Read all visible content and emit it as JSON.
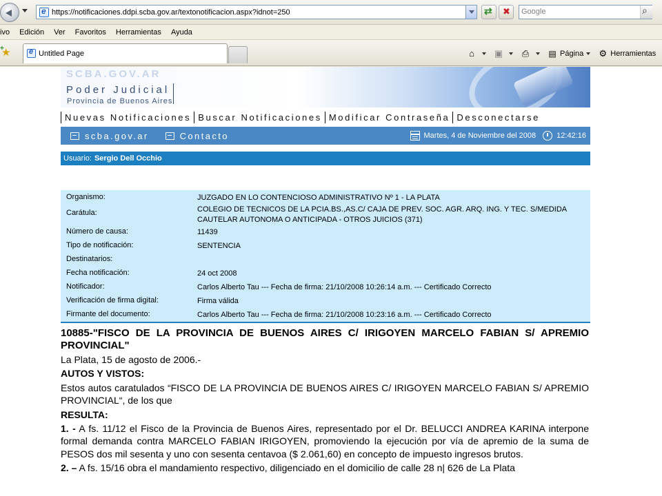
{
  "browser": {
    "url": "https://notificaciones.ddpi.scba.gov.ar/textonotificacion.aspx?idnot=250",
    "search_placeholder": "Google",
    "menu": [
      "ivo",
      "Edición",
      "Ver",
      "Favoritos",
      "Herramientas",
      "Ayuda"
    ],
    "tab_title": "Untitled Page",
    "tools": {
      "page": "Página",
      "tools": "Herramientas"
    }
  },
  "banner": {
    "brand": "SCBA.GOV.AR",
    "title": "Poder Judicial",
    "subtitle": "Provincia de Buenos Aires"
  },
  "nav": {
    "items": [
      "Nuevas Notificaciones",
      "Buscar Notificaciones",
      "Modificar Contraseña",
      "Desconectarse"
    ]
  },
  "subnav": {
    "site": "scba.gov.ar",
    "contact": "Contacto",
    "date": "Martes, 4 de Noviembre del 2008",
    "time": "12:42:16"
  },
  "user": {
    "label": "Usuario:",
    "name": "Sergio Dell Occhio"
  },
  "info": {
    "rows": [
      {
        "label": "Organismo:",
        "value": "JUZGADO EN LO CONTENCIOSO ADMINISTRATIVO Nº 1 - LA PLATA"
      },
      {
        "label": "Carátula:",
        "value": "COLEGIO DE TECNICOS DE LA PCIA.BS.,AS.C/ CAJA DE PREV. SOC. AGR. ARQ. ING. Y TEC. S/MEDIDA CAUTELAR AUTONOMA O ANTICIPADA - OTROS JUICIOS (371)"
      },
      {
        "label": "Número de causa:",
        "value": "11439"
      },
      {
        "label": "Tipo de notificación:",
        "value": "SENTENCIA"
      },
      {
        "label": "Destinatarios:",
        "value": ""
      },
      {
        "label": "Fecha notificación:",
        "value": "24 oct 2008"
      },
      {
        "label": "Notificador:",
        "value": "Carlos Alberto Tau --- Fecha de firma: 21/10/2008 10:26:14 a.m. --- Certificado Correcto"
      },
      {
        "label": "Verificación de firma digital:",
        "value": "Firma válida"
      },
      {
        "label": "Firmante del documento:",
        "value": "Carlos Alberto Tau --- Fecha de firma: 21/10/2008 10:23:16 a.m. --- Certificado Correcto"
      }
    ]
  },
  "document": {
    "title": "10885-\"FISCO DE LA PROVINCIA DE BUENOS AIRES C/ IRIGOYEN MARCELO FABIAN S/ APREMIO PROVINCIAL\"",
    "date_line": "La Plata, 15 de agosto de 2006.-",
    "autos_heading": "AUTOS Y VISTOS:",
    "autos_text": "Estos autos caratulados “FISCO DE LA PROVINCIA DE BUENOS AIRES C/ IRIGOYEN MARCELO FABIAN S/ APREMIO PROVINCIAL“, de los que",
    "resulta_heading": "RESULTA:",
    "p1_num": "1. -",
    "p1_text": " A fs. 11/12 el Fisco de la Provincia de Buenos Aires, representado por el Dr. BELUCCI ANDREA KARINA interpone formal demanda contra MARCELO FABIAN IRIGOYEN, promoviendo la ejecución por vía de apremio de la suma de PESOS dos mil sesenta y uno con sesenta centavoa ($ 2.061,60) en concepto de impuesto ingresos brutos.",
    "p2_num": "2. –",
    "p2_text": " A fs. 15/16 obra el mandamiento respectivo, diligenciado en el domicilio de calle 28 n| 626 de La Plata"
  }
}
